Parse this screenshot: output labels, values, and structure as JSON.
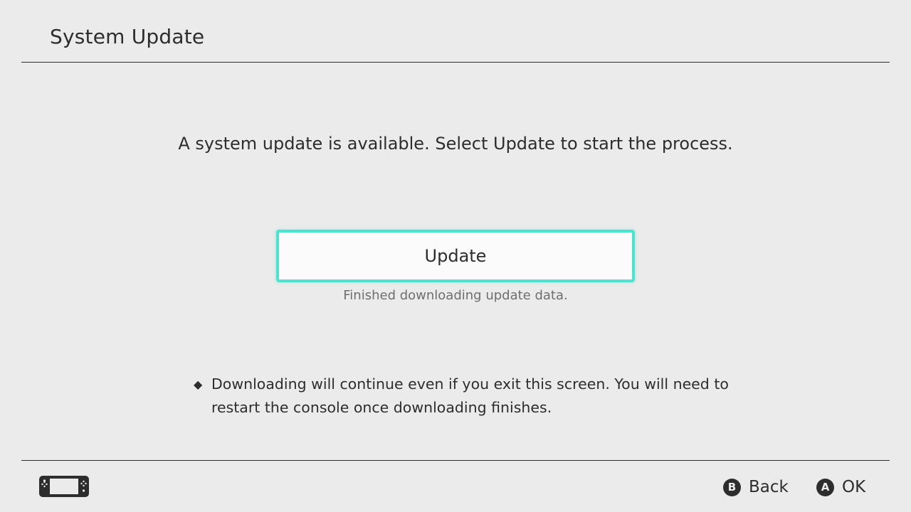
{
  "header": {
    "title": "System Update"
  },
  "main": {
    "message": "A system update is available. Select Update to start the process.",
    "update_label": "Update",
    "status": "Finished downloading update data.",
    "note_bullet": "◆",
    "note": "Downloading will continue even if you exit this screen. You will need to restart the console once downloading finishes."
  },
  "footer": {
    "console_icon": "handheld-console-icon",
    "back": {
      "glyph": "B",
      "label": "Back"
    },
    "ok": {
      "glyph": "A",
      "label": "OK"
    }
  },
  "colors": {
    "background": "#ebebeb",
    "text": "#2d2d2d",
    "selection_border": "#4fe2cf",
    "secondary_text": "#6e6e6e"
  }
}
